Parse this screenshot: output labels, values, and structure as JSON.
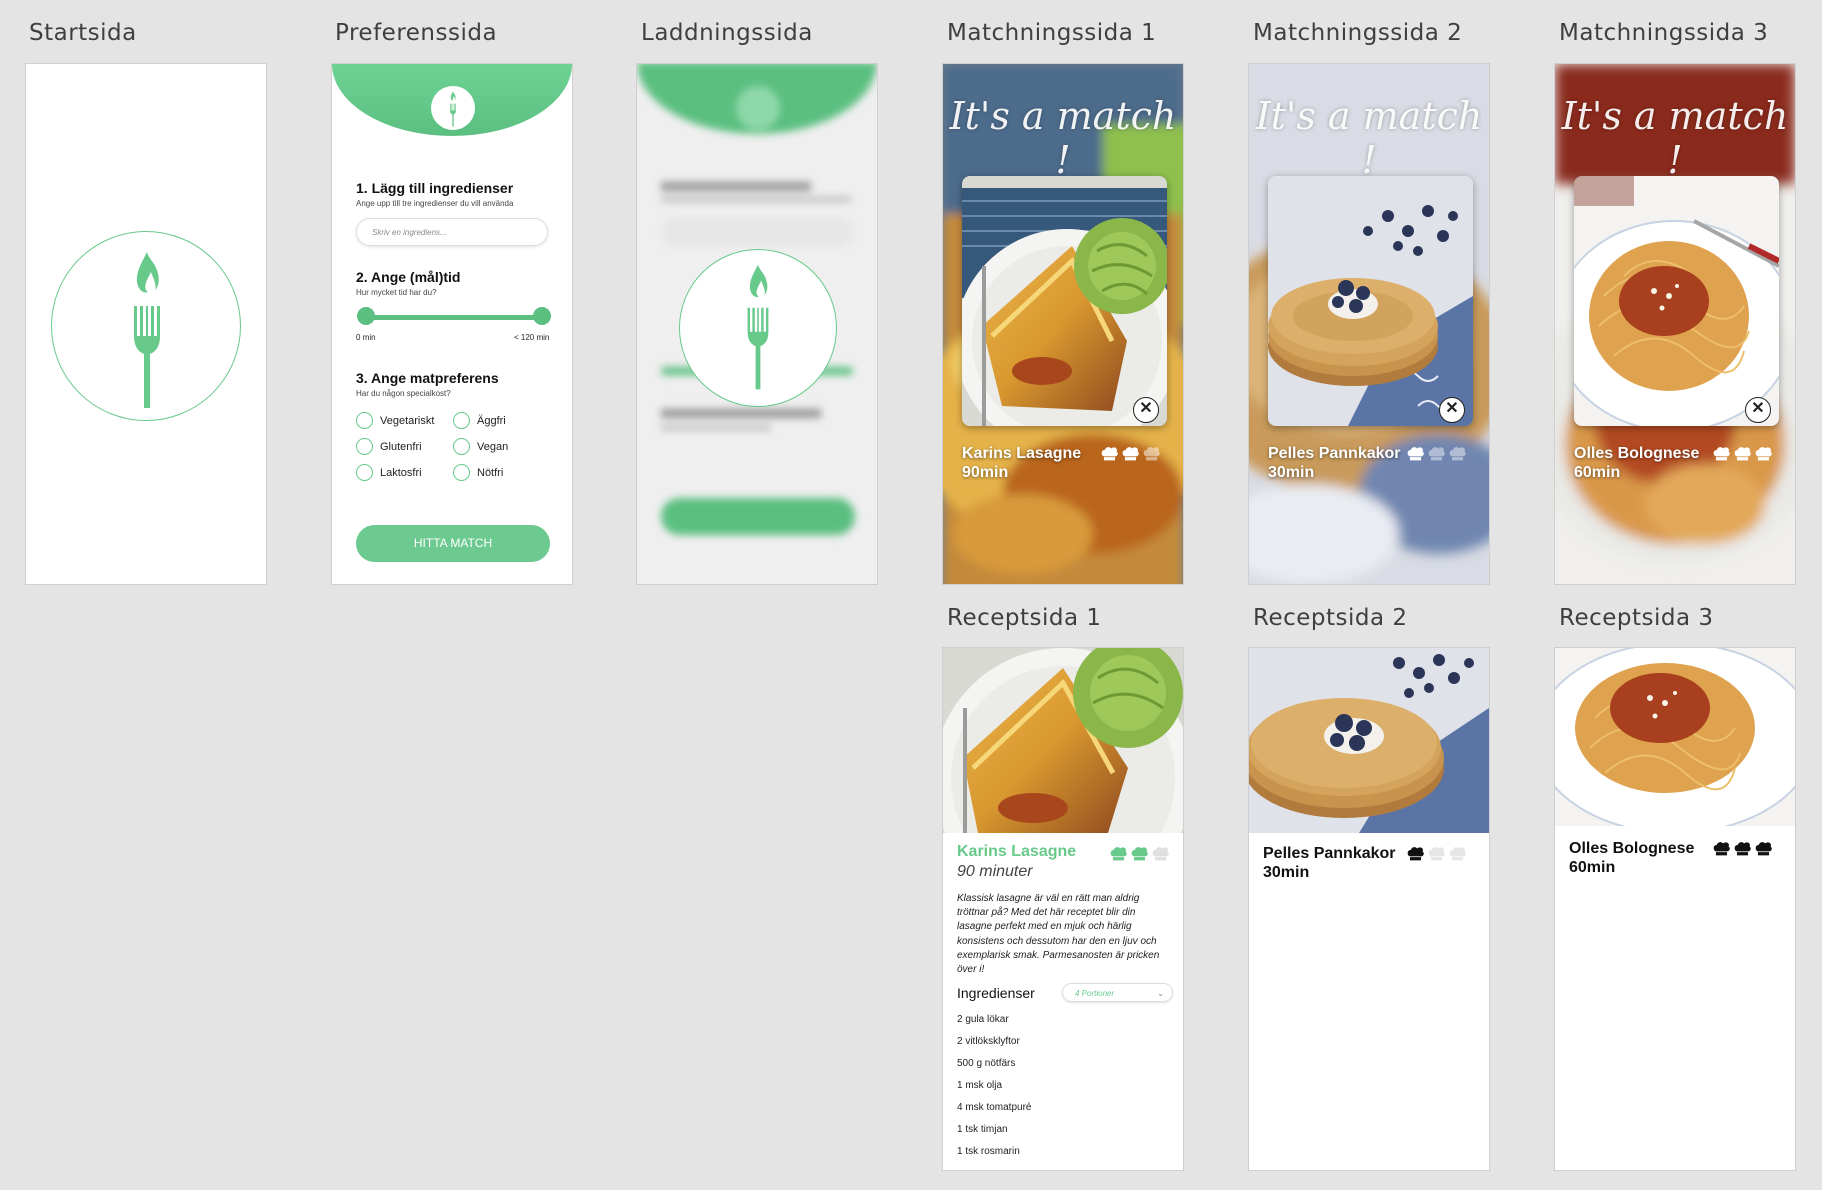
{
  "artboards": {
    "startsida": "Startsida",
    "preferenssida": "Preferenssida",
    "laddningssida": "Laddningssida",
    "match1": "Matchningssida 1",
    "match2": "Matchningssida 2",
    "match3": "Matchningssida 3",
    "recept1": "Receptsida 1",
    "recept2": "Receptsida 2",
    "recept3": "Receptsida 3"
  },
  "preferences": {
    "q1_title": "1. Lägg till ingredienser",
    "q1_sub": "Ange upp till tre ingredienser du vill använda",
    "ingredient_placeholder": "Skriv en ingrediens...",
    "q2_title": "2. Ange (mål)tid",
    "q2_sub": "Hur mycket tid har du?",
    "slider_min": "0 min",
    "slider_max": "< 120 min",
    "q3_title": "3. Ange matpreferens",
    "q3_sub": "Har du någon specialkost?",
    "options": [
      "Vegetariskt",
      "Äggfri",
      "Glutenfri",
      "Vegan",
      "Laktosfri",
      "Nötfri"
    ],
    "button": "HITTA MATCH"
  },
  "match_title": "It's a match !",
  "matches": [
    {
      "name": "Karins Lasagne",
      "time": "90min",
      "hats_filled": 2
    },
    {
      "name": "Pelles Pannkakor",
      "time": "30min",
      "hats_filled": 1
    },
    {
      "name": "Olles Bolognese",
      "time": "60min",
      "hats_filled": 3
    }
  ],
  "recipe1": {
    "name": "Karins Lasagne",
    "time": "90 minuter",
    "hats_filled": 2,
    "description": "Klassisk lasagne är väl en rätt man aldrig tröttnar på? Med det här receptet blir din lasagne perfekt med en mjuk och härlig konsistens och dessutom har den en ljuv och exemplarisk smak. Parmesanosten är pricken över i!",
    "ingredients_heading": "Ingredienser",
    "portions": "4 Portioner",
    "ingredients": [
      "2 gula lökar",
      "2 vitlöksklyftor",
      "500 g nötfärs",
      "1 msk olja",
      "4 msk tomatpuré",
      "1 tsk timjan",
      "1 tsk rosmarin"
    ]
  },
  "recipe2": {
    "name": "Pelles Pannkakor",
    "time": "30min",
    "hats_filled": 1
  },
  "recipe3": {
    "name": "Olles Bolognese",
    "time": "60min",
    "hats_filled": 3
  },
  "colors": {
    "accent": "#67c98a",
    "background": "#e4e4e4"
  },
  "icons": {
    "logo": "fork-flame-icon",
    "close": "utensils-cross-icon",
    "rating": "chef-hat-icon",
    "dropdown": "chevron-down-icon"
  }
}
